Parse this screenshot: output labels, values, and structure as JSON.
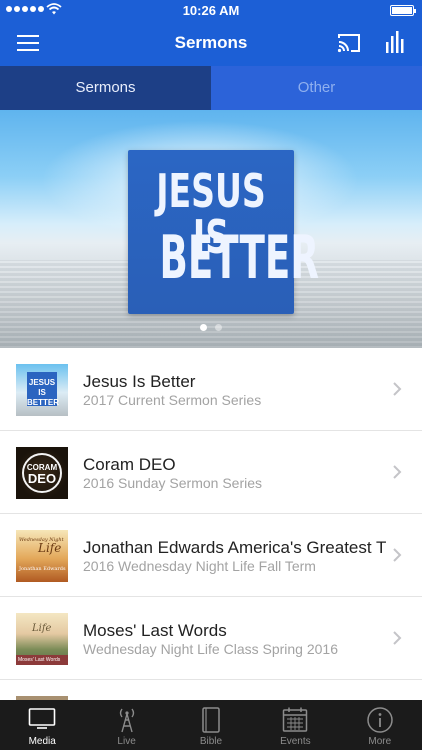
{
  "status_bar": {
    "time": "10:26 AM"
  },
  "nav": {
    "title": "Sermons",
    "menu_icon": "hamburger-menu-icon",
    "cast_icon": "cast-icon",
    "chart_icon": "bar-chart-icon"
  },
  "tabs": [
    {
      "label": "Sermons",
      "active": true
    },
    {
      "label": "Other",
      "active": false
    }
  ],
  "hero": {
    "line1": "JESUS IS",
    "line2": "BETTER",
    "pages": 2,
    "current_page": 1
  },
  "series": [
    {
      "title": "Jesus Is Better",
      "subtitle": "2017 Current Sermon Series",
      "thumb_text": "JESUS IS BETTER"
    },
    {
      "title": "Coram DEO",
      "subtitle": "2016 Sunday Sermon Series",
      "thumb_text_1": "CORAM",
      "thumb_text_2": "DEO"
    },
    {
      "title": "Jonathan Edwards America's Greatest T",
      "subtitle": "2016 Wednesday Night Life Fall Term",
      "thumb_text_1": "Wednesday Night",
      "thumb_text_2": "Life",
      "thumb_text_3": "Jonathan Edwards"
    },
    {
      "title": "Moses' Last Words",
      "subtitle": "Wednesday Night Life Class Spring 2016",
      "thumb_text_1": "Life",
      "thumb_text_2": "Moses' Last Words"
    }
  ],
  "tabbar": [
    {
      "label": "Media",
      "icon": "tv-icon",
      "active": true
    },
    {
      "label": "Live",
      "icon": "broadcast-tower-icon",
      "active": false
    },
    {
      "label": "Bible",
      "icon": "book-icon",
      "active": false
    },
    {
      "label": "Events",
      "icon": "calendar-icon",
      "active": false
    },
    {
      "label": "More",
      "icon": "info-icon",
      "active": false
    }
  ],
  "colors": {
    "nav_blue": "#1c5fd6",
    "active_tab": "#1d3f86",
    "inactive_tab": "#2c63d9",
    "tabbar": "#1b1b1b"
  }
}
